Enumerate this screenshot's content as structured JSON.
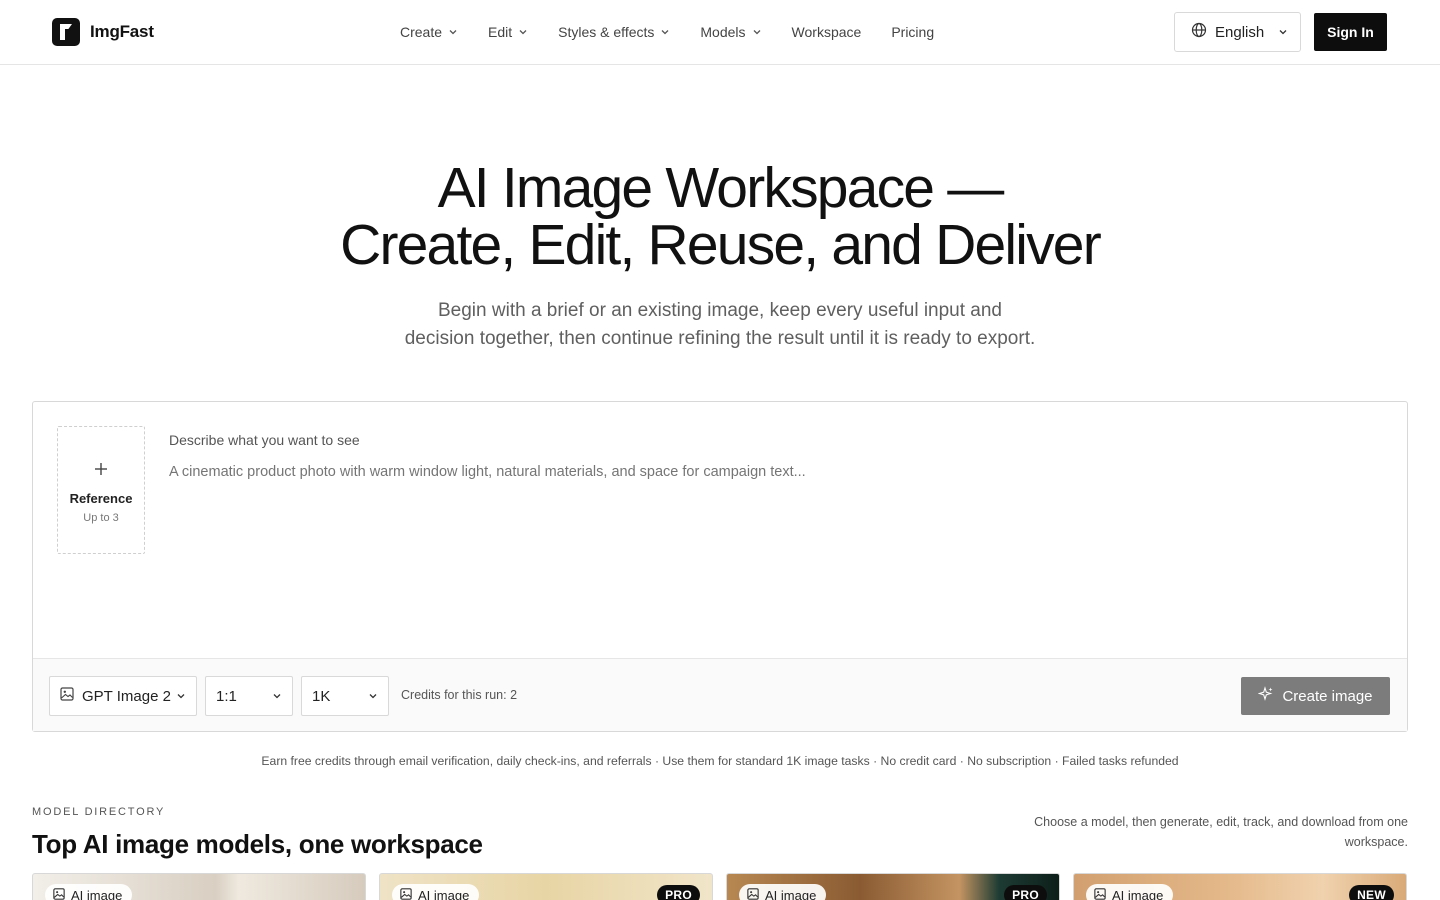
{
  "header": {
    "brand": "ImgFast",
    "nav": [
      {
        "label": "Create",
        "dropdown": true
      },
      {
        "label": "Edit",
        "dropdown": true
      },
      {
        "label": "Styles & effects",
        "dropdown": true
      },
      {
        "label": "Models",
        "dropdown": true
      },
      {
        "label": "Workspace",
        "dropdown": false
      },
      {
        "label": "Pricing",
        "dropdown": false
      }
    ],
    "language": "English",
    "signin": "Sign In"
  },
  "hero": {
    "title_line1": "AI Image Workspace —",
    "title_line2": "Create, Edit, Reuse, and Deliver",
    "sub_line1": "Begin with a brief or an existing image, keep every useful input and",
    "sub_line2": "decision together, then continue refining the result until it is ready to export."
  },
  "composer": {
    "reference_label": "Reference",
    "reference_sub": "Up to 3",
    "prompt_label": "Describe what you want to see",
    "prompt_placeholder": "A cinematic product photo with warm window light, natural materials, and space for campaign text...",
    "model": "GPT Image 2",
    "ratio": "1:1",
    "resolution": "1K",
    "credits": "Credits for this run: 2",
    "create_label": "Create image"
  },
  "fine_print": "Earn free credits through email verification, daily check-ins, and referrals · Use them for standard 1K image tasks · No credit card · No subscription · Failed tasks refunded",
  "directory": {
    "eyebrow": "MODEL DIRECTORY",
    "title": "Top AI image models, one workspace",
    "description": "Choose a model, then generate, edit, track, and download from one workspace.",
    "cards": [
      {
        "badge": "AI image",
        "tag": ""
      },
      {
        "badge": "AI image",
        "tag": "PRO"
      },
      {
        "badge": "AI image",
        "tag": "PRO"
      },
      {
        "badge": "AI image",
        "tag": "NEW"
      }
    ]
  },
  "colors": {
    "primary": "#0d0d0d",
    "create_button": "#7c7c7c",
    "border": "#d8d8d8"
  }
}
